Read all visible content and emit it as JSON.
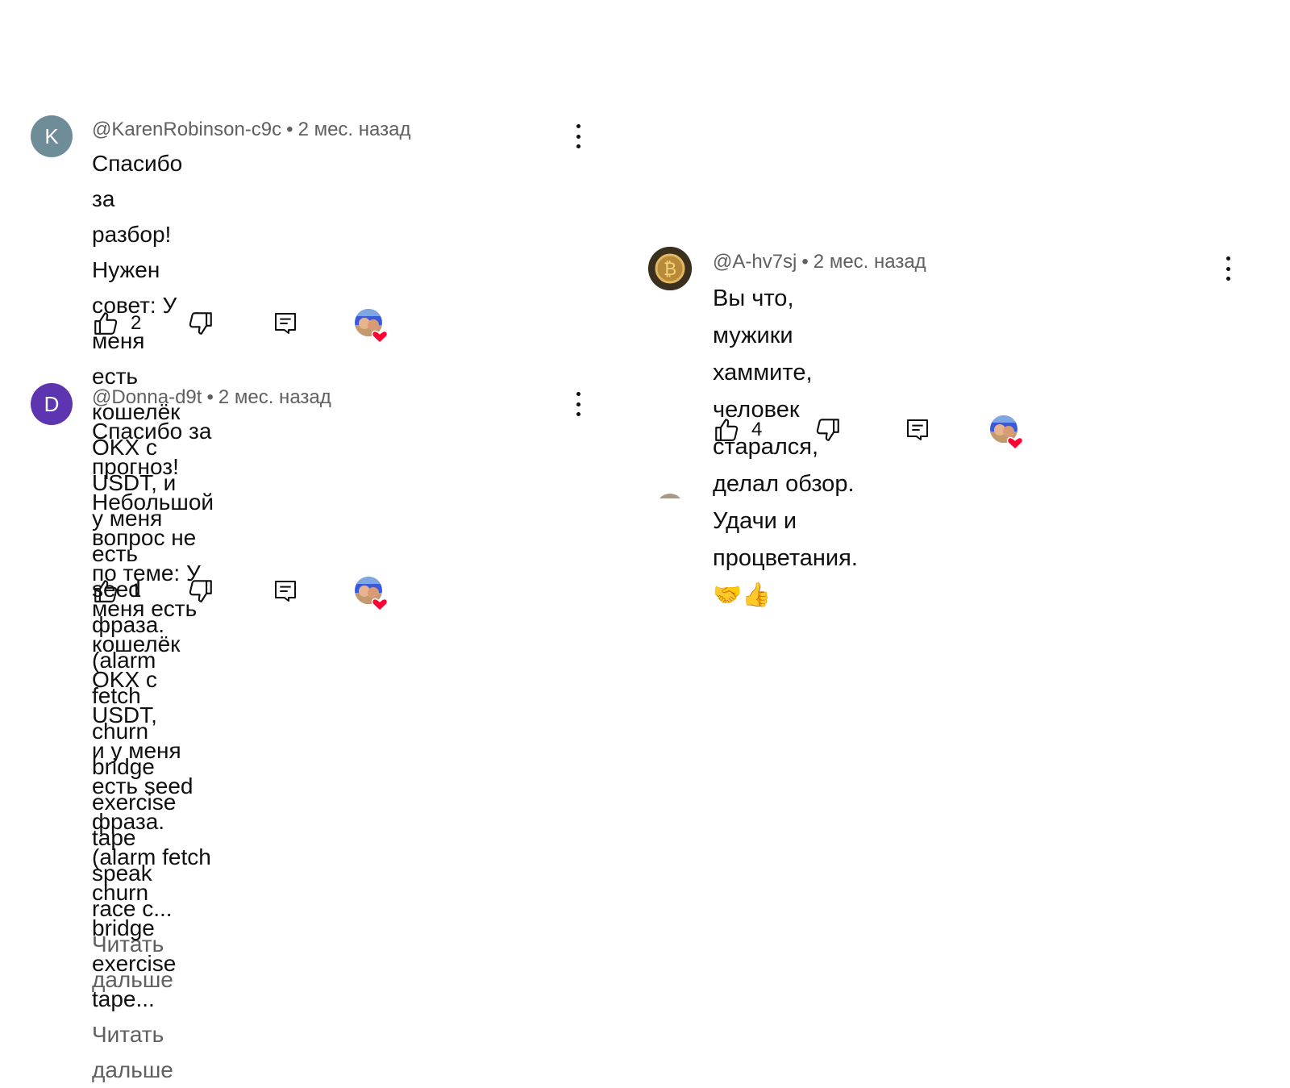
{
  "comments": [
    {
      "avatar_letter": "K",
      "avatar_color": "#6f8d99",
      "author": "@KarenRobinson-c9c",
      "time": "2 мес. назад",
      "lines": [
        "Спасибо за разбор! Нужен совет: У меня",
        "есть кошелёк OKX с USDT, и у меня есть",
        "seed фраза. (alarm fetch churn bridge",
        "exercise tape speak race c..."
      ],
      "read_more": "Читать дальше",
      "likes": "2"
    },
    {
      "avatar_letter": "D",
      "avatar_color": "#5e35b1",
      "author": "@Donna-d9t",
      "time": "2 мес. назад",
      "lines": [
        "Спасибо за прогноз! Небольшой вопрос не",
        "по теме: У меня есть кошелёк OKX с USDT,",
        "и у меня есть seed фраза. (alarm fetch",
        "churn bridge exercise tape..."
      ],
      "read_more": "Читать дальше",
      "likes": "1"
    },
    {
      "avatar_letter": "",
      "avatar_color": "#3b2f1e",
      "author": "@A-hv7sj",
      "time": "2 мес. назад",
      "lines": [
        "Вы что, мужики хаммите, человек",
        "старался, делал обзор. Удачи и",
        "процветания.🤝👍"
      ],
      "read_more": "",
      "likes": "4"
    }
  ],
  "separator": "•",
  "icons": {
    "like": "thumb-up-icon",
    "dislike": "thumb-down-icon",
    "reply": "reply-icon",
    "heart": "creator-heart-icon",
    "more": "more-vert-icon"
  },
  "colors": {
    "heart": "#ff0033",
    "secondary_text": "#606060"
  }
}
